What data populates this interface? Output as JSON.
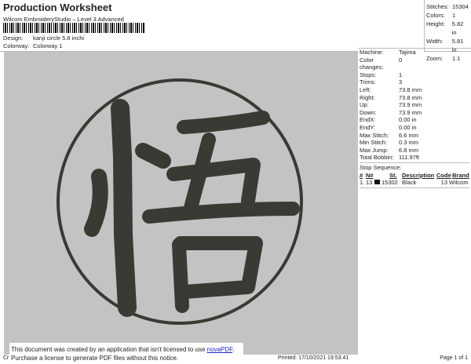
{
  "header": {
    "title": "Production Worksheet",
    "subtitle": "Wilcom EmbroideryStudio – Level 3 Advanced",
    "design_label": "Design:",
    "design_value": "kanji circle 5.8 inchi",
    "colorway_label": "Colorway:",
    "colorway_value": "Colorway 1"
  },
  "stats": [
    {
      "k": "Stitches:",
      "v": "15304"
    },
    {
      "k": "Colors:",
      "v": "1"
    },
    {
      "k": "Height:",
      "v": "5.82 in"
    },
    {
      "k": "Width:",
      "v": "5.81 in"
    },
    {
      "k": "Zoom:",
      "v": "1:1"
    }
  ],
  "details": [
    {
      "k": "Machine:",
      "v": "Tajima"
    },
    {
      "k": "Color changes:",
      "v": "0"
    },
    {
      "k": "Stops:",
      "v": "1"
    },
    {
      "k": "Trims:",
      "v": "3"
    },
    {
      "k": "Left:",
      "v": "73.8 mm"
    },
    {
      "k": "Right:",
      "v": "73.8 mm"
    },
    {
      "k": "Up:",
      "v": "73.9 mm"
    },
    {
      "k": "Down:",
      "v": "73.9 mm"
    },
    {
      "k": "EndX:",
      "v": "0.00 in"
    },
    {
      "k": "EndY:",
      "v": "0.00 in"
    },
    {
      "k": "Max Stitch:",
      "v": "6.6 mm"
    },
    {
      "k": "Min Stitch:",
      "v": "0.3 mm"
    },
    {
      "k": "Max Jump:",
      "v": "6.8 mm"
    },
    {
      "k": "Total Bobbin:",
      "v": "111.97ft"
    }
  ],
  "stop_sequence": {
    "label": "Stop Sequence:",
    "headers": [
      "#",
      "N#",
      "St.",
      "Description",
      "Code",
      "Brand"
    ],
    "rows": [
      {
        "num": "1.",
        "n": "13",
        "st": "15302",
        "desc": "Black",
        "code": "13",
        "brand": "Wilcom",
        "color": "#111111"
      }
    ]
  },
  "design_colors": {
    "thread": "#3b3933",
    "background": "#c3c3c3"
  },
  "footer": {
    "left": "Cr",
    "printed": "Printed: 17/10/2021 19.53.41",
    "page": "Page 1 of 1"
  },
  "notice": {
    "line1": "This document was created by an application that isn't licensed to use ",
    "link": "novaPDF",
    "line1_end": ".",
    "line2": "Purchase a license to generate PDF files without this notice."
  }
}
